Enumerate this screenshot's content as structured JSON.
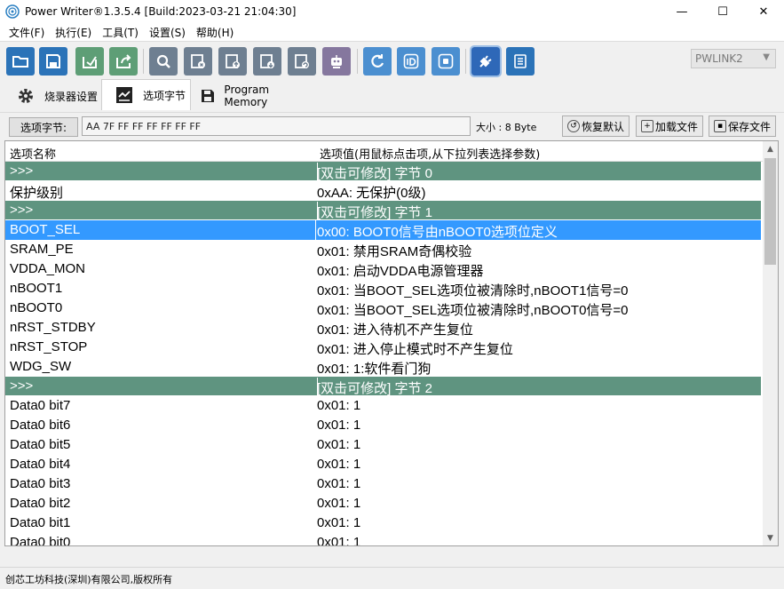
{
  "window": {
    "title": "Power Writer®1.3.5.4 [Build:2023-03-21 21:04:30]",
    "minimize": "—",
    "maximize": "☐",
    "close": "✕"
  },
  "menu": [
    "文件(F)",
    "执行(E)",
    "工具(T)",
    "设置(S)",
    "帮助(H)"
  ],
  "toolbar": {
    "buttons": [
      {
        "icon": "open-folder-icon"
      },
      {
        "icon": "save-icon"
      },
      {
        "icon": "import-icon"
      },
      {
        "icon": "export-icon"
      },
      {
        "icon": "search-icon"
      },
      {
        "icon": "erase-chip-icon"
      },
      {
        "icon": "program-chip-icon"
      },
      {
        "icon": "read-chip-icon"
      },
      {
        "icon": "verify-chip-icon"
      },
      {
        "icon": "robot-icon"
      },
      {
        "icon": "refresh-icon"
      },
      {
        "icon": "id-icon"
      },
      {
        "icon": "target-icon"
      },
      {
        "icon": "plug-icon"
      },
      {
        "icon": "config-icon"
      }
    ],
    "device": "PWLINK2"
  },
  "tabs": [
    "烧录器设置",
    "选项字节",
    "Program Memory"
  ],
  "option_bar": {
    "label": "选项字节:",
    "value": "AA 7F FF FF FF FF FF FF",
    "size": "大小 : 8 Byte",
    "restore": "恢复默认",
    "load": "加载文件",
    "save": "保存文件"
  },
  "grid": {
    "col_name": "选项名称",
    "col_value": "选项值(用鼠标点击项,从下拉列表选择参数)",
    "rows": [
      {
        "type": "sec",
        "name": ">>>",
        "value": "[双击可修改] 字节 0"
      },
      {
        "type": "row",
        "name": "保护级别",
        "value": "0xAA: 无保护(0级)"
      },
      {
        "type": "sec",
        "name": ">>>",
        "value": "[双击可修改] 字节 1"
      },
      {
        "type": "sel",
        "name": "BOOT_SEL",
        "value": "0x00: BOOT0信号由nBOOT0选项位定义"
      },
      {
        "type": "row",
        "name": "SRAM_PE",
        "value": "0x01: 禁用SRAM奇偶校验"
      },
      {
        "type": "row",
        "name": "VDDA_MON",
        "value": "0x01: 启动VDDA电源管理器"
      },
      {
        "type": "row",
        "name": "nBOOT1",
        "value": "0x01: 当BOOT_SEL选项位被清除时,nBOOT1信号=0"
      },
      {
        "type": "row",
        "name": "nBOOT0",
        "value": "0x01: 当BOOT_SEL选项位被清除时,nBOOT0信号=0"
      },
      {
        "type": "row",
        "name": "nRST_STDBY",
        "value": "0x01: 进入待机不产生复位"
      },
      {
        "type": "row",
        "name": "nRST_STOP",
        "value": "0x01: 进入停止模式时不产生复位"
      },
      {
        "type": "row",
        "name": "WDG_SW",
        "value": "0x01: 1:软件看门狗"
      },
      {
        "type": "sec",
        "name": ">>>",
        "value": "[双击可修改] 字节 2"
      },
      {
        "type": "row",
        "name": "Data0 bit7",
        "value": "0x01: 1"
      },
      {
        "type": "row",
        "name": "Data0 bit6",
        "value": "0x01: 1"
      },
      {
        "type": "row",
        "name": "Data0 bit5",
        "value": "0x01: 1"
      },
      {
        "type": "row",
        "name": "Data0 bit4",
        "value": "0x01: 1"
      },
      {
        "type": "row",
        "name": "Data0 bit3",
        "value": "0x01: 1"
      },
      {
        "type": "row",
        "name": "Data0 bit2",
        "value": "0x01: 1"
      },
      {
        "type": "row",
        "name": "Data0 bit1",
        "value": "0x01: 1"
      },
      {
        "type": "row",
        "name": "Data0 bit0",
        "value": "0x01: 1"
      }
    ]
  },
  "status": "创芯工坊科技(深圳)有限公司,版权所有"
}
